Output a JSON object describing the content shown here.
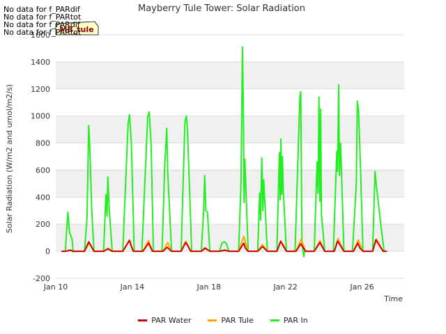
{
  "no_data_messages": [
    "No data for f_PARdif",
    "No data for f_PARtot",
    "No data for f_PARdif",
    "No data for f_PARtot"
  ],
  "chart_data": {
    "type": "line",
    "title": "Mayberry Tule Tower: Solar Radiation",
    "xlabel": "Time",
    "ylabel": "Solar Radiation (W/m2 and umol/m2/s)",
    "xlim": [
      0,
      18.2
    ],
    "ylim": [
      -200,
      1600
    ],
    "yticks": [
      -200,
      0,
      200,
      400,
      600,
      800,
      1000,
      1200,
      1400,
      1600
    ],
    "xticks": [
      {
        "x": 0,
        "label": "Jan 10"
      },
      {
        "x": 4,
        "label": "Jan 14"
      },
      {
        "x": 8,
        "label": "Jan 18"
      },
      {
        "x": 12,
        "label": "Jan 22"
      },
      {
        "x": 16,
        "label": "Jan 26"
      }
    ],
    "grid": true,
    "legend_position": "bottom",
    "annotation_box": "MB_tule",
    "colors": {
      "par_water": "#cc0000",
      "par_tule": "#ffa500",
      "par_in": "#22ee22"
    },
    "series": [
      {
        "name": "PAR Water",
        "color": "#cc0000",
        "days": [
          {
            "start": 10.5,
            "end": 10.9,
            "peaks": [
              {
                "t": 10.75,
                "v": 8
              }
            ]
          },
          {
            "start": 11.5,
            "end": 12.0,
            "peaks": [
              {
                "t": 11.72,
                "v": 70
              },
              {
                "t": 11.82,
                "v": 45
              }
            ]
          },
          {
            "start": 12.5,
            "end": 12.95,
            "peaks": [
              {
                "t": 12.72,
                "v": 18
              }
            ]
          },
          {
            "start": 13.5,
            "end": 14.05,
            "peaks": [
              {
                "t": 13.85,
                "v": 80
              },
              {
                "t": 13.95,
                "v": 35
              }
            ]
          },
          {
            "start": 14.55,
            "end": 15.05,
            "peaks": [
              {
                "t": 14.85,
                "v": 60
              },
              {
                "t": 14.95,
                "v": 30
              }
            ]
          },
          {
            "start": 15.6,
            "end": 16.05,
            "peaks": [
              {
                "t": 15.82,
                "v": 30
              }
            ]
          },
          {
            "start": 16.55,
            "end": 17.05,
            "peaks": [
              {
                "t": 16.78,
                "v": 65
              },
              {
                "t": 16.9,
                "v": 40
              }
            ]
          },
          {
            "start": 17.6,
            "end": 18.05,
            "peaks": [
              {
                "t": 17.8,
                "v": 25
              }
            ]
          },
          {
            "start": 18.55,
            "end": 19.05,
            "peaks": [
              {
                "t": 18.85,
                "v": 8
              }
            ]
          },
          {
            "start": 19.55,
            "end": 20.05,
            "peaks": [
              {
                "t": 19.82,
                "v": 60
              },
              {
                "t": 19.9,
                "v": 25
              }
            ]
          },
          {
            "start": 20.55,
            "end": 21.05,
            "peaks": [
              {
                "t": 20.8,
                "v": 35
              }
            ]
          },
          {
            "start": 21.55,
            "end": 22.05,
            "peaks": [
              {
                "t": 21.75,
                "v": 75
              },
              {
                "t": 21.88,
                "v": 40
              }
            ]
          },
          {
            "start": 22.55,
            "end": 23.05,
            "peaks": [
              {
                "t": 22.8,
                "v": 55
              }
            ]
          },
          {
            "start": 23.5,
            "end": 24.05,
            "peaks": [
              {
                "t": 23.8,
                "v": 65
              }
            ]
          },
          {
            "start": 24.55,
            "end": 25.05,
            "peaks": [
              {
                "t": 24.72,
                "v": 75
              },
              {
                "t": 24.88,
                "v": 40
              }
            ]
          },
          {
            "start": 25.55,
            "end": 26.05,
            "peaks": [
              {
                "t": 25.78,
                "v": 60
              },
              {
                "t": 25.88,
                "v": 25
              }
            ]
          },
          {
            "start": 26.55,
            "end": 27.1,
            "peaks": [
              {
                "t": 26.72,
                "v": 85
              }
            ]
          }
        ]
      },
      {
        "name": "PAR Tule",
        "color": "#ffa500",
        "days": [
          {
            "start": 10.5,
            "end": 10.95,
            "peaks": [
              {
                "t": 10.8,
                "v": 10
              }
            ]
          },
          {
            "start": 11.5,
            "end": 12.0,
            "peaks": [
              {
                "t": 11.75,
                "v": 60
              },
              {
                "t": 11.85,
                "v": 40
              }
            ]
          },
          {
            "start": 12.5,
            "end": 12.95,
            "peaks": [
              {
                "t": 12.75,
                "v": 22
              }
            ]
          },
          {
            "start": 13.5,
            "end": 14.05,
            "peaks": [
              {
                "t": 13.85,
                "v": 85
              }
            ]
          },
          {
            "start": 14.55,
            "end": 15.05,
            "peaks": [
              {
                "t": 14.85,
                "v": 80
              }
            ]
          },
          {
            "start": 15.6,
            "end": 16.05,
            "peaks": [
              {
                "t": 15.85,
                "v": 65
              }
            ]
          },
          {
            "start": 16.55,
            "end": 17.05,
            "peaks": [
              {
                "t": 16.8,
                "v": 75
              }
            ]
          },
          {
            "start": 17.6,
            "end": 18.05,
            "peaks": [
              {
                "t": 17.8,
                "v": 18
              }
            ]
          },
          {
            "start": 18.55,
            "end": 19.05,
            "peaks": [
              {
                "t": 18.85,
                "v": 10
              }
            ]
          },
          {
            "start": 19.55,
            "end": 20.05,
            "peaks": [
              {
                "t": 19.82,
                "v": 110
              },
              {
                "t": 19.92,
                "v": 60
              }
            ]
          },
          {
            "start": 20.55,
            "end": 21.05,
            "peaks": [
              {
                "t": 20.8,
                "v": 50
              }
            ]
          },
          {
            "start": 21.55,
            "end": 22.05,
            "peaks": [
              {
                "t": 21.75,
                "v": 70
              },
              {
                "t": 21.88,
                "v": 50
              }
            ]
          },
          {
            "start": 22.55,
            "end": 23.05,
            "peaks": [
              {
                "t": 22.82,
                "v": 90
              }
            ]
          },
          {
            "start": 23.5,
            "end": 24.05,
            "peaks": [
              {
                "t": 23.8,
                "v": 80
              }
            ]
          },
          {
            "start": 24.55,
            "end": 25.05,
            "peaks": [
              {
                "t": 24.75,
                "v": 95
              },
              {
                "t": 24.85,
                "v": 60
              }
            ]
          },
          {
            "start": 25.55,
            "end": 26.05,
            "peaks": [
              {
                "t": 25.8,
                "v": 85
              }
            ]
          },
          {
            "start": 26.55,
            "end": 27.1,
            "peaks": [
              {
                "t": 26.75,
                "v": 90
              }
            ]
          }
        ]
      },
      {
        "name": "PAR In",
        "color": "#22ee22",
        "days": [
          {
            "start": 10.5,
            "end": 10.95,
            "peaks": [
              {
                "t": 10.63,
                "v": 290
              },
              {
                "t": 10.72,
                "v": 140
              },
              {
                "t": 10.85,
                "v": 90
              }
            ],
            "end_value": -5
          },
          {
            "start": 11.5,
            "end": 12.0,
            "peaks": [
              {
                "t": 11.63,
                "v": 240
              },
              {
                "t": 11.72,
                "v": 930
              },
              {
                "t": 11.78,
                "v": 760
              },
              {
                "t": 11.82,
                "v": 580
              },
              {
                "t": 11.88,
                "v": 310
              }
            ]
          },
          {
            "start": 12.5,
            "end": 12.95,
            "peaks": [
              {
                "t": 12.62,
                "v": 420
              },
              {
                "t": 12.68,
                "v": 260
              },
              {
                "t": 12.72,
                "v": 550
              },
              {
                "t": 12.8,
                "v": 300
              }
            ]
          },
          {
            "start": 13.5,
            "end": 14.1,
            "peaks": [
              {
                "t": 13.78,
                "v": 940
              },
              {
                "t": 13.85,
                "v": 1010
              },
              {
                "t": 13.95,
                "v": 800
              }
            ]
          },
          {
            "start": 14.5,
            "end": 15.1,
            "peaks": [
              {
                "t": 14.8,
                "v": 990
              },
              {
                "t": 14.88,
                "v": 1030
              },
              {
                "t": 14.98,
                "v": 800
              }
            ]
          },
          {
            "start": 15.55,
            "end": 16.05,
            "peaks": [
              {
                "t": 15.7,
                "v": 660
              },
              {
                "t": 15.75,
                "v": 780
              },
              {
                "t": 15.8,
                "v": 910
              },
              {
                "t": 15.85,
                "v": 580
              }
            ]
          },
          {
            "start": 16.55,
            "end": 17.1,
            "peaks": [
              {
                "t": 16.75,
                "v": 960
              },
              {
                "t": 16.82,
                "v": 1000
              },
              {
                "t": 16.88,
                "v": 900
              }
            ]
          },
          {
            "start": 17.6,
            "end": 18.05,
            "peaks": [
              {
                "t": 17.72,
                "v": 290
              },
              {
                "t": 17.78,
                "v": 560
              },
              {
                "t": 17.84,
                "v": 300
              },
              {
                "t": 17.92,
                "v": 290
              }
            ]
          },
          {
            "start": 18.55,
            "end": 19.05,
            "peaks": [
              {
                "t": 18.68,
                "v": 60
              },
              {
                "t": 18.8,
                "v": 70
              },
              {
                "t": 18.9,
                "v": 60
              }
            ]
          },
          {
            "start": 19.55,
            "end": 20.05,
            "peaks": [
              {
                "t": 19.68,
                "v": 520
              },
              {
                "t": 19.75,
                "v": 1510
              },
              {
                "t": 19.8,
                "v": 1050
              },
              {
                "t": 19.84,
                "v": 360
              },
              {
                "t": 19.88,
                "v": 680
              }
            ]
          },
          {
            "start": 20.55,
            "end": 21.05,
            "peaks": [
              {
                "t": 20.65,
                "v": 430
              },
              {
                "t": 20.7,
                "v": 230
              },
              {
                "t": 20.76,
                "v": 690
              },
              {
                "t": 20.82,
                "v": 300
              },
              {
                "t": 20.86,
                "v": 530
              }
            ]
          },
          {
            "start": 21.55,
            "end": 22.05,
            "peaks": [
              {
                "t": 21.68,
                "v": 730
              },
              {
                "t": 21.72,
                "v": 380
              },
              {
                "t": 21.76,
                "v": 830
              },
              {
                "t": 21.8,
                "v": 420
              },
              {
                "t": 21.84,
                "v": 700
              },
              {
                "t": 21.88,
                "v": 460
              }
            ]
          },
          {
            "start": 22.5,
            "end": 23.0,
            "peaks": [
              {
                "t": 22.75,
                "v": 1140
              },
              {
                "t": 22.8,
                "v": 1180
              },
              {
                "t": 22.86,
                "v": 60
              }
            ],
            "end_value": -40
          },
          {
            "start": 23.5,
            "end": 24.05,
            "peaks": [
              {
                "t": 23.65,
                "v": 660
              },
              {
                "t": 23.7,
                "v": 430
              },
              {
                "t": 23.75,
                "v": 1140
              },
              {
                "t": 23.8,
                "v": 370
              },
              {
                "t": 23.84,
                "v": 1050
              },
              {
                "t": 23.88,
                "v": 270
              }
            ]
          },
          {
            "start": 24.5,
            "end": 25.05,
            "peaks": [
              {
                "t": 24.68,
                "v": 740
              },
              {
                "t": 24.72,
                "v": 590
              },
              {
                "t": 24.78,
                "v": 1230
              },
              {
                "t": 24.82,
                "v": 560
              },
              {
                "t": 24.88,
                "v": 800
              }
            ]
          },
          {
            "start": 25.5,
            "end": 26.05,
            "peaks": [
              {
                "t": 25.7,
                "v": 500
              },
              {
                "t": 25.75,
                "v": 1110
              },
              {
                "t": 25.82,
                "v": 1030
              },
              {
                "t": 25.9,
                "v": 700
              }
            ]
          },
          {
            "start": 26.55,
            "end": 27.15,
            "peaks": [
              {
                "t": 26.68,
                "v": 590
              },
              {
                "t": 26.75,
                "v": 480
              },
              {
                "t": 26.85,
                "v": 360
              },
              {
                "t": 26.95,
                "v": 230
              }
            ]
          }
        ]
      }
    ]
  }
}
